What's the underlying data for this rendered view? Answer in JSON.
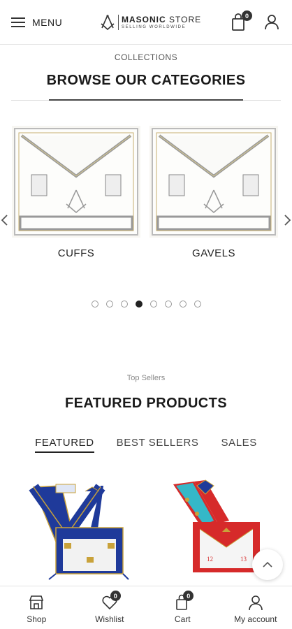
{
  "header": {
    "menu_label": "MENU",
    "logo_title_bold": "MASONIC",
    "logo_title_rest": " STORE",
    "logo_subtitle": "SELLING WORLDWIDE",
    "cart_count": "0"
  },
  "categories": {
    "eyebrow": "COLLECTIONS",
    "title": "BROWSE OUR CATEGORIES",
    "items": [
      {
        "label": "CUFFS"
      },
      {
        "label": "GAVELS"
      }
    ],
    "slide_count": 8,
    "active_slide": 4
  },
  "featured": {
    "eyebrow": "Top Sellers",
    "title": "FEATURED PRODUCTS",
    "tabs": [
      {
        "label": "FEATURED",
        "active": true
      },
      {
        "label": "BEST SELLERS",
        "active": false
      },
      {
        "label": "SALES",
        "active": false
      }
    ]
  },
  "bottom_nav": [
    {
      "label": "Shop",
      "icon": "shop-icon"
    },
    {
      "label": "Wishlist",
      "icon": "heart-icon",
      "badge": "0"
    },
    {
      "label": "Cart",
      "icon": "cart-icon",
      "badge": "0"
    },
    {
      "label": "My account",
      "icon": "user-icon"
    }
  ],
  "colors": {
    "apron_blue": "#1f3a9a",
    "apron_red": "#d62a2a",
    "apron_sky": "#35b8c8",
    "gold": "#c9a23a"
  }
}
